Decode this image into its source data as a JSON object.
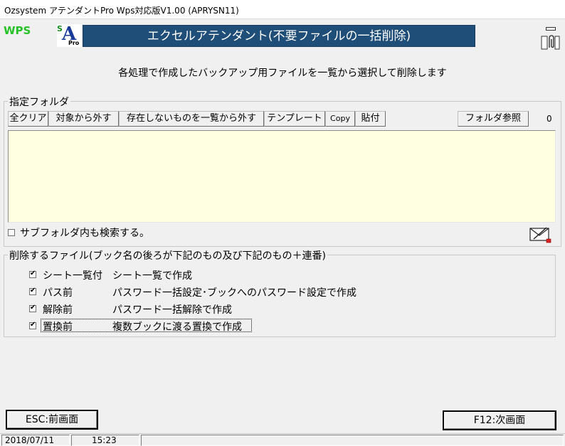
{
  "window": {
    "title": "Ozsystem アテンダントPro Wps対応版V1.00 (APRYSN11)"
  },
  "header": {
    "wps_logo": "WPS",
    "sa_logo_s": "S",
    "sa_logo_a": "A",
    "sa_logo_pro": "Pro",
    "banner": "エクセルアテンダント(不要ファイルの一括削除)",
    "menu_icon": "window-menu-icon",
    "clip_icon": "paperclip-icon"
  },
  "subtitle": "各処理で作成したバックアップ用ファイルを一覧から選択して削除します",
  "folder_group": {
    "legend": "指定フォルダ",
    "buttons": {
      "clear_all": "全クリア",
      "exclude": "対象から外す",
      "exclude_missing": "存在しないものを一覧から外す",
      "template": "テンプレート",
      "copy": "Copy",
      "paste": "貼付",
      "browse": "フォルダ参照"
    },
    "count": "0",
    "subfolder_label": "サブフォルダ内も検索する。",
    "subfolder_checked": false,
    "mail_icon": "envelope-edit-icon"
  },
  "delete_group": {
    "legend": "削除するファイル(ブック名の後ろが下記のもの及び下記のもの＋連番)",
    "items": [
      {
        "label": "シート一覧付",
        "desc": "シート一覧で作成",
        "checked": true
      },
      {
        "label": "パス前",
        "desc": "パスワード一括設定･ブックへのパスワード設定で作成",
        "checked": true
      },
      {
        "label": "解除前",
        "desc": "パスワード一括解除で作成",
        "checked": true
      },
      {
        "label": "置換前",
        "desc": "複数ブックに渡る置換で作成",
        "checked": true
      }
    ]
  },
  "footer": {
    "esc_button": "ESC:前画面",
    "f12_button": "F12:次画面"
  },
  "status": {
    "date": "2018/07/11",
    "time": "15:23"
  }
}
